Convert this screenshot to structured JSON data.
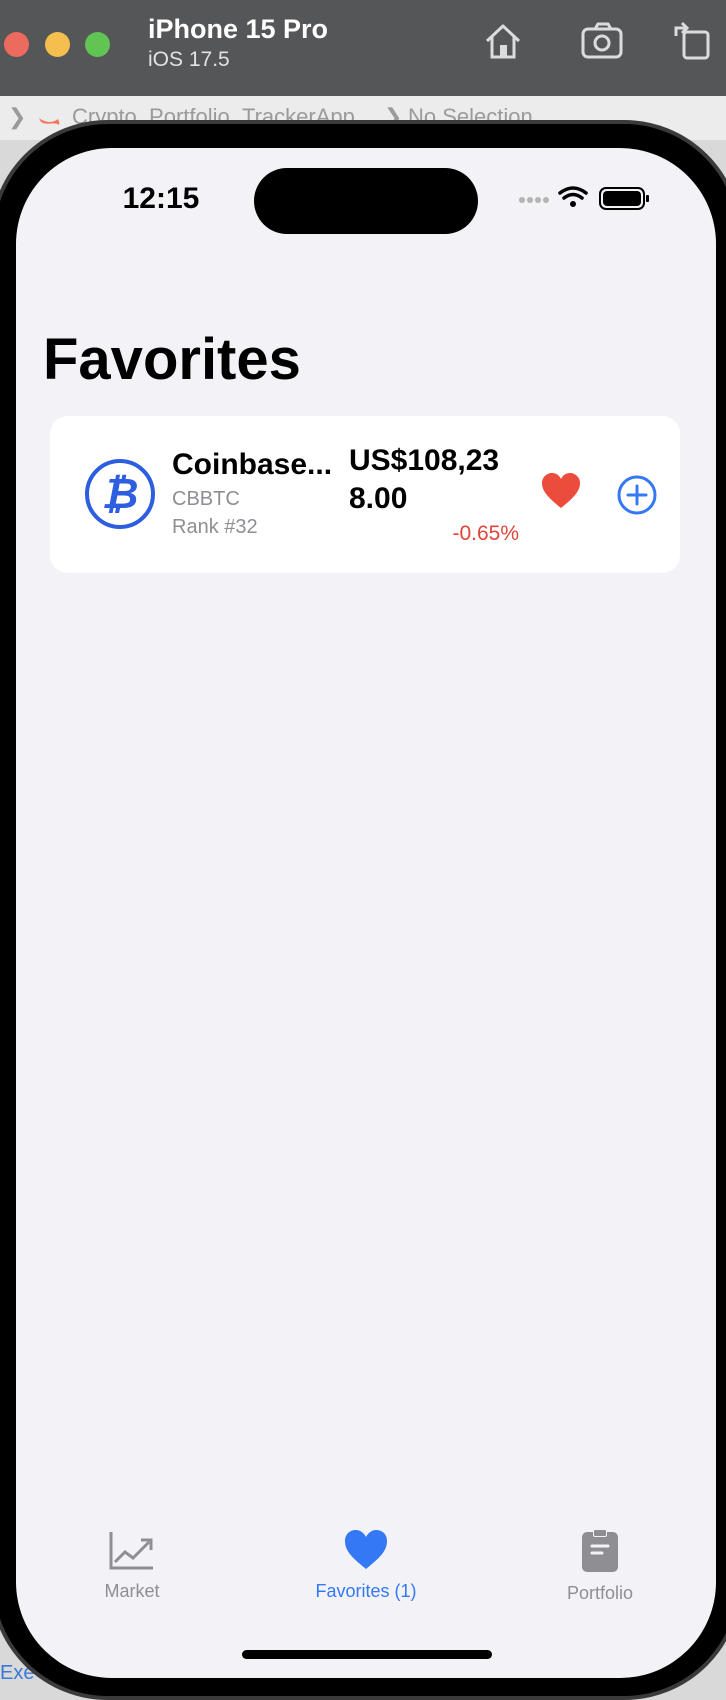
{
  "simulator": {
    "device": "iPhone 15 Pro",
    "os": "iOS 17.5",
    "breadcrumb_project": "Crypto_Portfolio_TrackerApp",
    "breadcrumb_selection": "No Selection",
    "footer_text": "Exe"
  },
  "status_bar": {
    "time": "12:15"
  },
  "page": {
    "title": "Favorites"
  },
  "favorites": [
    {
      "name": "Coinbase...",
      "symbol": "CBBTC",
      "rank": "Rank #32",
      "price": "US$108,238.00",
      "change": "-0.65%",
      "icon": "bitcoin-icon"
    }
  ],
  "tabs": [
    {
      "label": "Market",
      "icon": "chart-icon",
      "selected": false
    },
    {
      "label": "Favorites (1)",
      "icon": "heart-icon",
      "selected": true
    },
    {
      "label": "Portfolio",
      "icon": "clipboard-icon",
      "selected": false
    }
  ],
  "colors": {
    "accent": "#3478f6",
    "negative": "#e0443a",
    "favorite": "#ec4c3c",
    "background": "#f2f2f7"
  }
}
